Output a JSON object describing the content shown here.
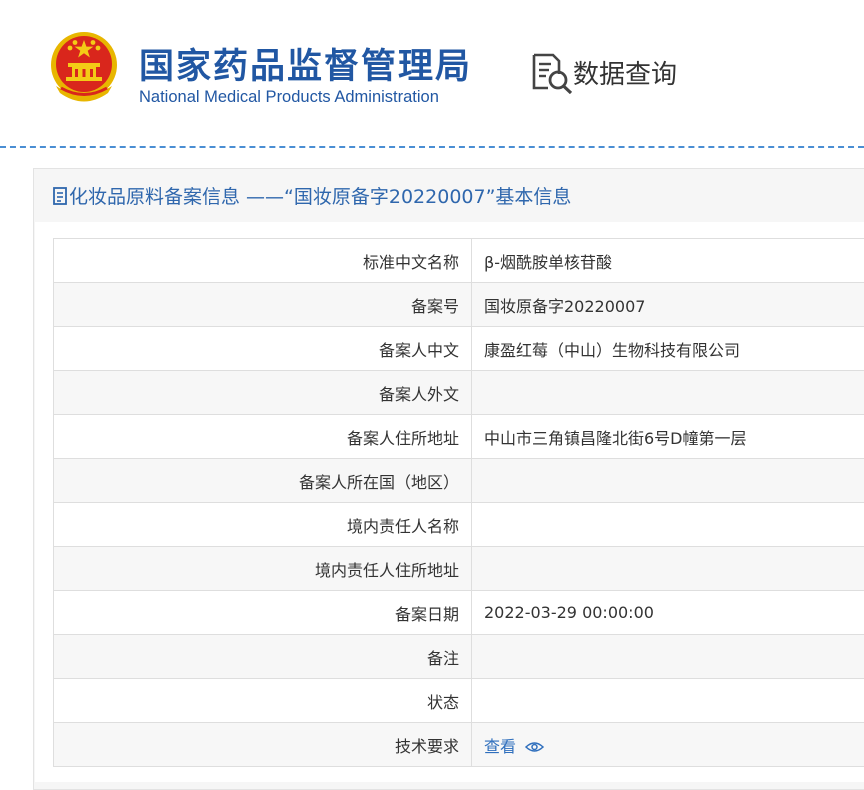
{
  "header": {
    "org_name_cn": "国家药品监督管理局",
    "org_name_en": "National Medical Products Administration",
    "query_label": "数据查询",
    "logo_icon": "national-emblem-icon",
    "query_icon": "data-search-icon"
  },
  "panel": {
    "title": "化妆品原料备案信息 ——“国妆原备字20220007”基本信息",
    "title_icon": "document-icon"
  },
  "rows": [
    {
      "label": "标准中文名称",
      "value": "β-烟酰胺单核苷酸"
    },
    {
      "label": "备案号",
      "value": "国妆原备字20220007"
    },
    {
      "label": "备案人中文",
      "value": "康盈红莓（中山）生物科技有限公司"
    },
    {
      "label": "备案人外文",
      "value": ""
    },
    {
      "label": "备案人住所地址",
      "value": "中山市三角镇昌隆北街6号D幢第一层"
    },
    {
      "label": "备案人所在国（地区）",
      "value": ""
    },
    {
      "label": "境内责任人名称",
      "value": ""
    },
    {
      "label": "境内责任人住所地址",
      "value": ""
    },
    {
      "label": "备案日期",
      "value": "2022-03-29 00:00:00"
    },
    {
      "label": "备注",
      "value": ""
    },
    {
      "label": "状态",
      "value": ""
    },
    {
      "label": "技术要求",
      "value": "查看",
      "link_icon": "eye-icon"
    }
  ],
  "colors": {
    "brand_blue": "#2157a3",
    "title_blue": "#2f67ad",
    "link_blue": "#2f6fbd",
    "emblem_red": "#d9261c",
    "emblem_gold": "#f2c200"
  }
}
